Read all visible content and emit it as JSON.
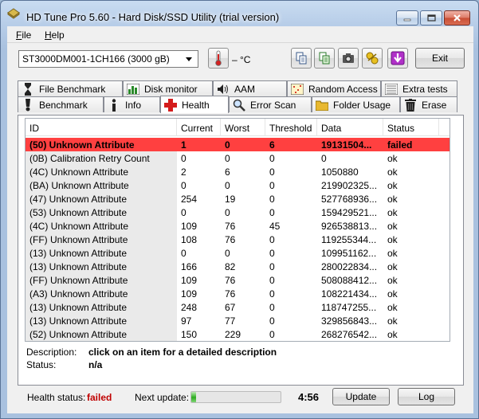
{
  "window": {
    "title": "HD Tune Pro 5.60 - Hard Disk/SSD Utility (trial version)"
  },
  "menu": {
    "file": "File",
    "help": "Help"
  },
  "toolbar": {
    "drive": "ST3000DM001-1CH166 (3000 gB)",
    "temperature": "– °C",
    "exit_label": "Exit"
  },
  "tabs": {
    "row1": [
      {
        "label": "File Benchmark",
        "icon": "file-benchmark-icon"
      },
      {
        "label": "Disk monitor",
        "icon": "disk-monitor-icon"
      },
      {
        "label": "AAM",
        "icon": "speaker-icon"
      },
      {
        "label": "Random Access",
        "icon": "random-access-icon"
      },
      {
        "label": "Extra tests",
        "icon": "extra-tests-icon"
      }
    ],
    "row2": [
      {
        "label": "Benchmark",
        "icon": "benchmark-icon"
      },
      {
        "label": "Info",
        "icon": "info-icon"
      },
      {
        "label": "Health",
        "icon": "health-cross-icon"
      },
      {
        "label": "Error Scan",
        "icon": "magnifier-icon"
      },
      {
        "label": "Folder Usage",
        "icon": "folder-icon"
      },
      {
        "label": "Erase",
        "icon": "trash-icon"
      }
    ],
    "active": "Health"
  },
  "table": {
    "columns": [
      "ID",
      "Current",
      "Worst",
      "Threshold",
      "Data",
      "Status"
    ],
    "rows": [
      [
        "(50) Unknown Attribute",
        "1",
        "0",
        "6",
        "19131504...",
        "failed"
      ],
      [
        "(0B) Calibration Retry Count",
        "0",
        "0",
        "0",
        "0",
        "ok"
      ],
      [
        "(4C) Unknown Attribute",
        "2",
        "6",
        "0",
        "1050880",
        "ok"
      ],
      [
        "(BA) Unknown Attribute",
        "0",
        "0",
        "0",
        "219902325...",
        "ok"
      ],
      [
        "(47) Unknown Attribute",
        "254",
        "19",
        "0",
        "527768936...",
        "ok"
      ],
      [
        "(53) Unknown Attribute",
        "0",
        "0",
        "0",
        "159429521...",
        "ok"
      ],
      [
        "(4C) Unknown Attribute",
        "109",
        "76",
        "45",
        "926538813...",
        "ok"
      ],
      [
        "(FF) Unknown Attribute",
        "108",
        "76",
        "0",
        "119255344...",
        "ok"
      ],
      [
        "(13) Unknown Attribute",
        "0",
        "0",
        "0",
        "109951162...",
        "ok"
      ],
      [
        "(13) Unknown Attribute",
        "166",
        "82",
        "0",
        "280022834...",
        "ok"
      ],
      [
        "(FF) Unknown Attribute",
        "109",
        "76",
        "0",
        "508088412...",
        "ok"
      ],
      [
        "(A3) Unknown Attribute",
        "109",
        "76",
        "0",
        "108221434...",
        "ok"
      ],
      [
        "(13) Unknown Attribute",
        "248",
        "67",
        "0",
        "118747255...",
        "ok"
      ],
      [
        "(13) Unknown Attribute",
        "97",
        "77",
        "0",
        "329856843...",
        "ok"
      ],
      [
        "(52) Unknown Attribute",
        "150",
        "229",
        "0",
        "268276542...",
        "ok"
      ]
    ],
    "selected_row": 0
  },
  "description": {
    "label": "Description:",
    "value": "click on an item for a detailed description",
    "status_label": "Status:",
    "status_value": "n/a"
  },
  "footer": {
    "health_label": "Health status:",
    "health_value": "failed",
    "next_update_label": "Next update:",
    "progress_fraction": 0.05,
    "countdown": "4:56",
    "update_label": "Update",
    "log_label": "Log"
  },
  "colors": {
    "failed_row": "#ff4040",
    "failed_text": "#c00000",
    "progress_green": "#37b32a"
  }
}
